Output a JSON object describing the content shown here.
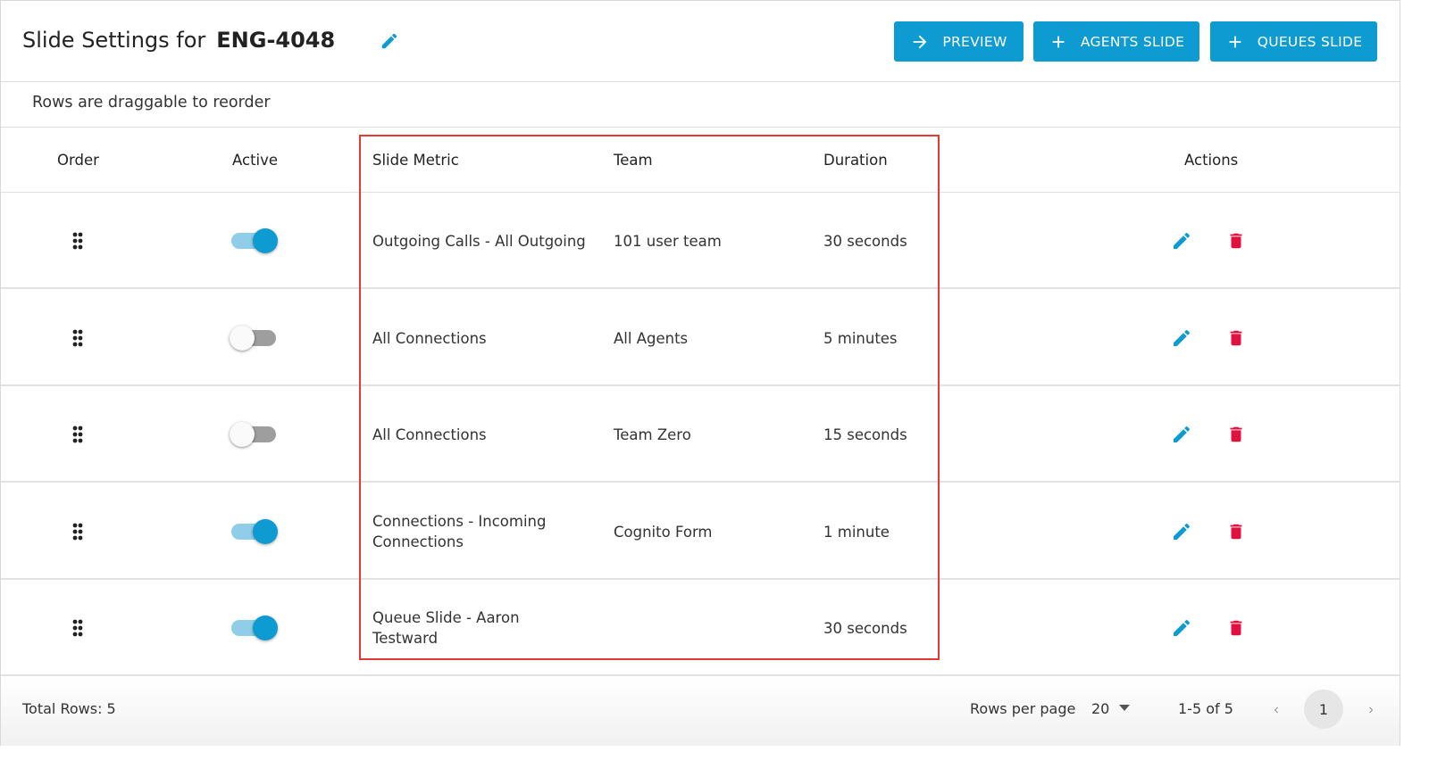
{
  "header": {
    "title_prefix": "Slide Settings for",
    "title_code": "ENG-4048",
    "buttons": {
      "preview": "PREVIEW",
      "agents_slide": "AGENTS SLIDE",
      "queues_slide": "QUEUES SLIDE"
    }
  },
  "hint": "Rows are draggable to reorder",
  "table": {
    "columns": {
      "order": "Order",
      "active": "Active",
      "metric": "Slide Metric",
      "team": "Team",
      "duration": "Duration",
      "actions": "Actions"
    },
    "rows": [
      {
        "active": true,
        "metric": "Outgoing Calls - All Outgoing",
        "team": "101 user team",
        "duration": "30 seconds"
      },
      {
        "active": false,
        "metric": "All Connections",
        "team": "All Agents",
        "duration": "5 minutes"
      },
      {
        "active": false,
        "metric": "All Connections",
        "team": "Team Zero",
        "duration": "15 seconds"
      },
      {
        "active": true,
        "metric": "Connections - Incoming Connections",
        "team": "Cognito Form",
        "duration": "1 minute"
      },
      {
        "active": true,
        "metric": "Queue Slide - Aaron Testward",
        "team": "",
        "duration": "30 seconds"
      }
    ]
  },
  "footer": {
    "total_rows": "Total Rows: 5",
    "rows_per_page_label": "Rows per page",
    "rows_per_page_value": "20",
    "range": "1-5 of 5",
    "current_page": "1"
  },
  "colors": {
    "accent": "#0e9bd1",
    "toggle_track_on": "#8fcde8",
    "toggle_track_off": "#9e9e9e",
    "delete": "#e0113e",
    "highlight_box": "#e53935"
  },
  "icons": {
    "title_edit": "pencil-icon",
    "preview": "arrow-right-icon",
    "add": "plus-icon",
    "drag": "drag-handle-icon",
    "edit": "pencil-icon",
    "delete": "trash-icon",
    "dropdown": "caret-down-icon",
    "prev": "chevron-left-icon",
    "next": "chevron-right-icon"
  }
}
